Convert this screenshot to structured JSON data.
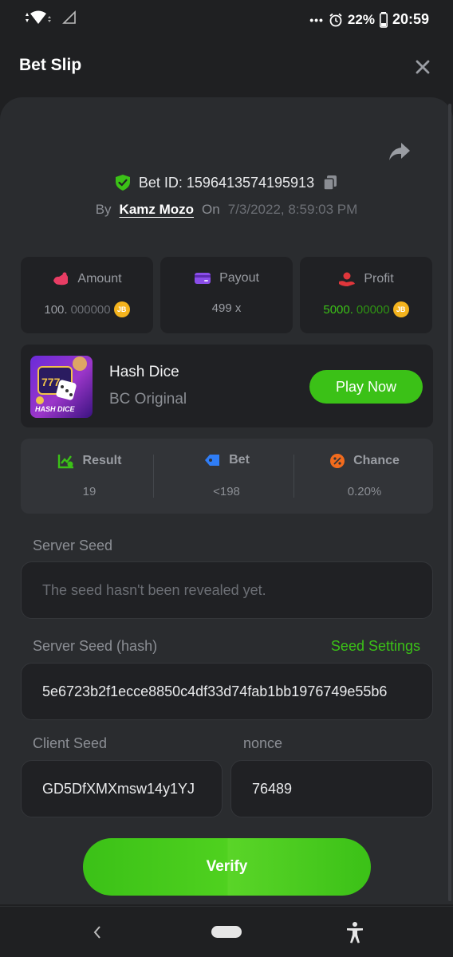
{
  "status_bar": {
    "battery": "22%",
    "time": "20:59"
  },
  "header": {
    "title": "Bet Slip"
  },
  "bet": {
    "id_label": "Bet ID: 1596413574195913",
    "by_label": "By",
    "user": "Kamz Mozo",
    "on_label": "On",
    "date": "7/3/2022, 8:59:03 PM"
  },
  "stats": {
    "amount_label": "Amount",
    "amount_int": "100.",
    "amount_dec": "000000",
    "payout_label": "Payout",
    "payout_value": "499 x",
    "profit_label": "Profit",
    "profit_int": "5000.",
    "profit_dec": "00000",
    "coin_symbol": "JB"
  },
  "game": {
    "thumb_label": "HASH DICE",
    "name": "Hash Dice",
    "subtitle": "BC Original",
    "play_label": "Play Now"
  },
  "result": {
    "result_label": "Result",
    "result_value": "19",
    "bet_label": "Bet",
    "bet_value": "<198",
    "chance_label": "Chance",
    "chance_value": "0.20%"
  },
  "seeds": {
    "server_seed_label": "Server Seed",
    "server_seed_value": "The seed hasn't been revealed yet.",
    "server_hash_label": "Server Seed (hash)",
    "seed_settings_label": "Seed Settings",
    "server_hash_value": "5e6723b2f1ecce8850c4df33d74fab1bb1976749e55b6",
    "client_seed_label": "Client Seed",
    "client_seed_value": "GD5DfXMXmsw14y1YJ",
    "nonce_label": "nonce",
    "nonce_value": "76489"
  },
  "verify_label": "Verify",
  "colors": {
    "accent": "#3bc117",
    "background": "#1f2022",
    "card": "#202124",
    "sheet": "#2a2c2f",
    "coin": "#f4b31d"
  },
  "icons": [
    "wifi-icon",
    "signal-icon",
    "alarm-icon",
    "battery-icon",
    "close-icon",
    "share-icon",
    "shield-check-icon",
    "copy-icon",
    "amount-icon",
    "payout-card-icon",
    "profit-icon",
    "coin-icon",
    "result-chart-icon",
    "bet-tag-icon",
    "chance-percent-icon",
    "back-icon",
    "home-pill-icon",
    "accessibility-icon"
  ]
}
